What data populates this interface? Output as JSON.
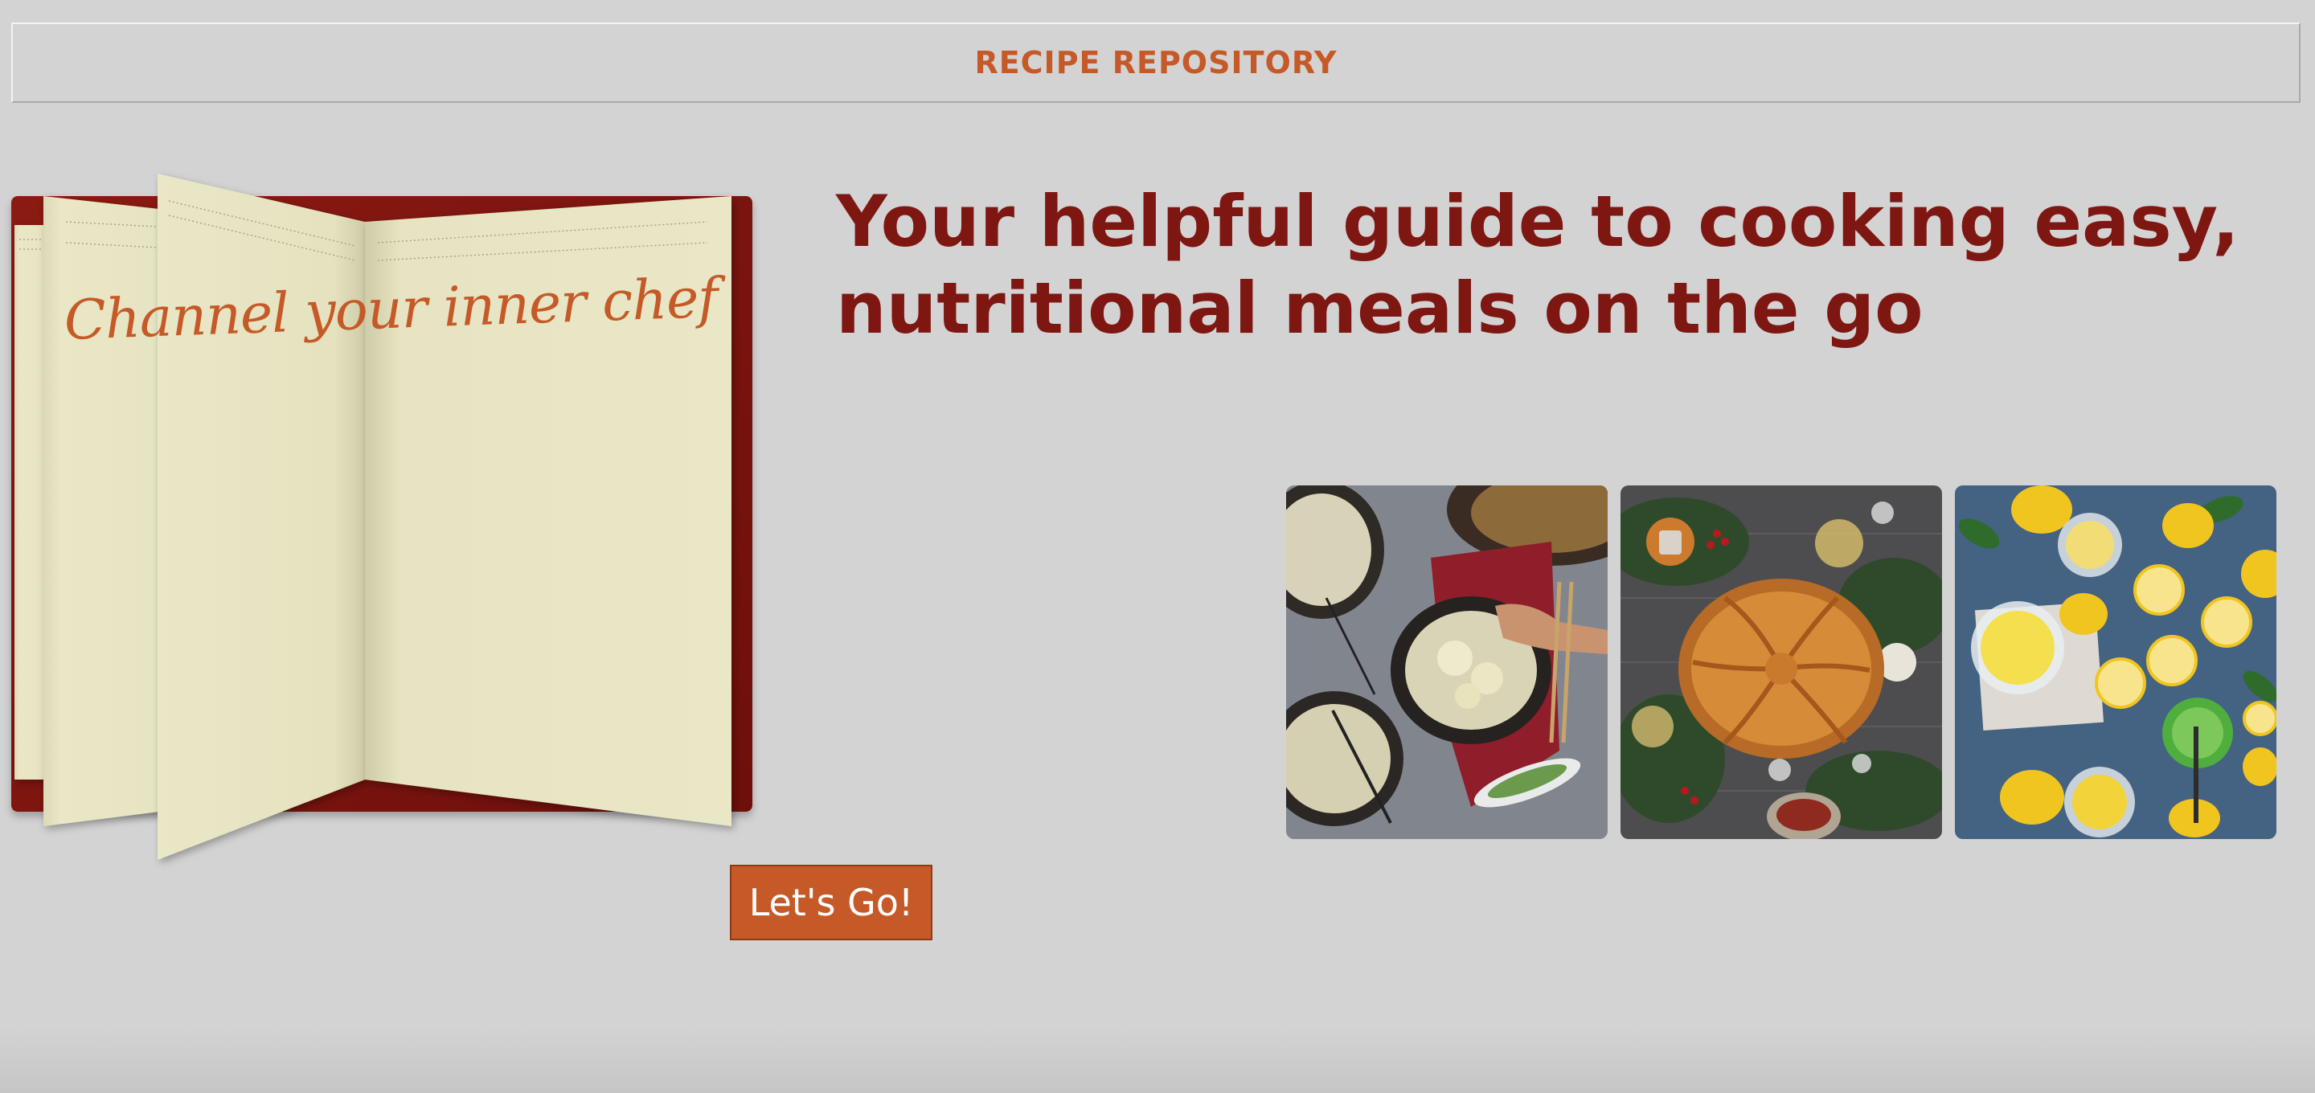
{
  "header": {
    "title": "RECIPE REPOSITORY"
  },
  "book": {
    "tagline": "Channel your inner chef"
  },
  "main": {
    "headline": "Your helpful guide to cooking easy, nutritional meals on the go"
  },
  "gallery": {
    "photos": [
      {
        "subject": "dumpling-noodle-bowls"
      },
      {
        "subject": "braided-pastry-bread"
      },
      {
        "subject": "lemons-and-lemon-curd"
      }
    ]
  },
  "cta": {
    "label": "Let's Go!"
  },
  "colors": {
    "background": "#d3d3d3",
    "accent_orange": "#c55a28",
    "headline_maroon": "#7e1712",
    "book_cover": "#8b1a12",
    "page_cream": "#e8e6c4"
  }
}
